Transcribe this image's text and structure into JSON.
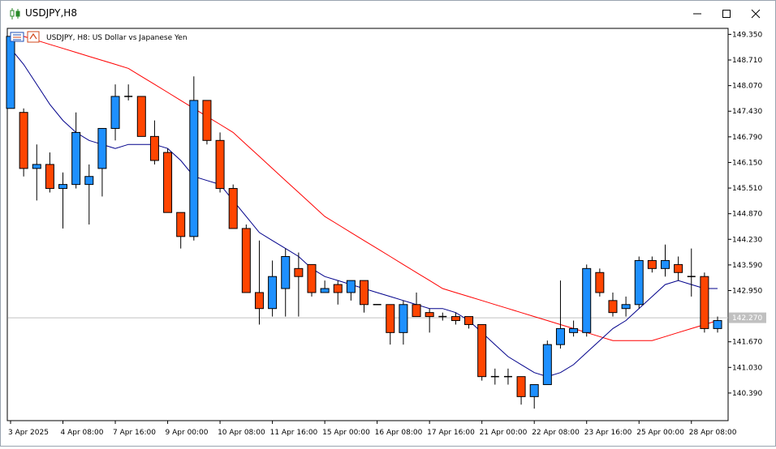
{
  "window": {
    "title": "USDJPY,H8"
  },
  "chart": {
    "symbol_label": "USDJPY, H8:  US Dollar vs Japanese Yen",
    "current_price": "142.270",
    "y_ticks": [
      "149.350",
      "148.710",
      "148.070",
      "147.430",
      "146.790",
      "146.150",
      "145.510",
      "144.870",
      "144.230",
      "143.590",
      "142.950",
      "141.670",
      "141.030",
      "140.390"
    ],
    "x_ticks": [
      "3 Apr 2025",
      "4 Apr 08:00",
      "7 Apr 16:00",
      "9 Apr 00:00",
      "10 Apr 08:00",
      "11 Apr 16:00",
      "15 Apr 00:00",
      "16 Apr 08:00",
      "17 Apr 16:00",
      "21 Apr 00:00",
      "22 Apr 08:00",
      "23 Apr 16:00",
      "25 Apr 00:00",
      "28 Apr 08:00"
    ],
    "colors": {
      "bull": "#1e90ff",
      "bear": "#ff4500",
      "fast_ma": "#00008b",
      "slow_ma": "#ff0000",
      "grid": "#c0c0c0"
    }
  },
  "chart_data": {
    "type": "candlestick",
    "ylim": [
      139.7,
      149.5
    ],
    "candles": [
      {
        "o": 147.5,
        "h": 149.4,
        "l": 147.5,
        "c": 149.3
      },
      {
        "o": 147.4,
        "h": 147.5,
        "l": 145.8,
        "c": 146.0
      },
      {
        "o": 146.0,
        "h": 146.6,
        "l": 145.2,
        "c": 146.1
      },
      {
        "o": 146.1,
        "h": 146.4,
        "l": 145.4,
        "c": 145.5
      },
      {
        "o": 145.5,
        "h": 145.9,
        "l": 144.5,
        "c": 145.6
      },
      {
        "o": 145.6,
        "h": 147.4,
        "l": 145.5,
        "c": 146.9
      },
      {
        "o": 145.6,
        "h": 146.1,
        "l": 144.6,
        "c": 145.8
      },
      {
        "o": 146.0,
        "h": 147.0,
        "l": 145.3,
        "c": 147.0
      },
      {
        "o": 147.0,
        "h": 148.1,
        "l": 146.7,
        "c": 147.8
      },
      {
        "o": 147.8,
        "h": 148.1,
        "l": 147.7,
        "c": 147.8
      },
      {
        "o": 147.8,
        "h": 147.8,
        "l": 146.8,
        "c": 146.8
      },
      {
        "o": 146.8,
        "h": 147.2,
        "l": 146.1,
        "c": 146.2
      },
      {
        "o": 146.4,
        "h": 146.5,
        "l": 144.9,
        "c": 144.9
      },
      {
        "o": 144.9,
        "h": 144.9,
        "l": 144.0,
        "c": 144.3
      },
      {
        "o": 144.3,
        "h": 148.3,
        "l": 144.2,
        "c": 147.7
      },
      {
        "o": 147.7,
        "h": 147.7,
        "l": 146.6,
        "c": 146.7
      },
      {
        "o": 146.7,
        "h": 146.9,
        "l": 145.4,
        "c": 145.5
      },
      {
        "o": 145.5,
        "h": 145.6,
        "l": 144.5,
        "c": 144.5
      },
      {
        "o": 144.5,
        "h": 144.6,
        "l": 142.9,
        "c": 142.9
      },
      {
        "o": 142.9,
        "h": 144.2,
        "l": 142.1,
        "c": 142.5
      },
      {
        "o": 142.5,
        "h": 143.7,
        "l": 142.3,
        "c": 143.3
      },
      {
        "o": 143.0,
        "h": 144.0,
        "l": 142.3,
        "c": 143.8
      },
      {
        "o": 143.5,
        "h": 143.9,
        "l": 142.3,
        "c": 143.3
      },
      {
        "o": 143.6,
        "h": 143.6,
        "l": 142.8,
        "c": 142.9
      },
      {
        "o": 142.9,
        "h": 143.2,
        "l": 142.9,
        "c": 143.0
      },
      {
        "o": 143.1,
        "h": 143.2,
        "l": 142.6,
        "c": 142.9
      },
      {
        "o": 142.9,
        "h": 143.1,
        "l": 142.7,
        "c": 143.2
      },
      {
        "o": 143.2,
        "h": 143.2,
        "l": 142.4,
        "c": 142.6
      },
      {
        "o": 142.6,
        "h": 142.6,
        "l": 142.6,
        "c": 142.6
      },
      {
        "o": 142.6,
        "h": 142.6,
        "l": 141.6,
        "c": 141.9
      },
      {
        "o": 141.9,
        "h": 142.7,
        "l": 141.6,
        "c": 142.6
      },
      {
        "o": 142.6,
        "h": 142.9,
        "l": 142.3,
        "c": 142.3
      },
      {
        "o": 142.4,
        "h": 142.5,
        "l": 141.9,
        "c": 142.3
      },
      {
        "o": 142.3,
        "h": 142.4,
        "l": 142.2,
        "c": 142.3
      },
      {
        "o": 142.3,
        "h": 142.4,
        "l": 142.1,
        "c": 142.2
      },
      {
        "o": 142.3,
        "h": 142.3,
        "l": 142.0,
        "c": 142.1
      },
      {
        "o": 142.1,
        "h": 142.1,
        "l": 140.7,
        "c": 140.8
      },
      {
        "o": 140.8,
        "h": 141.0,
        "l": 140.6,
        "c": 140.8
      },
      {
        "o": 140.8,
        "h": 141.0,
        "l": 140.6,
        "c": 140.8
      },
      {
        "o": 140.8,
        "h": 140.8,
        "l": 140.1,
        "c": 140.3
      },
      {
        "o": 140.3,
        "h": 140.6,
        "l": 140.0,
        "c": 140.6
      },
      {
        "o": 140.6,
        "h": 141.7,
        "l": 140.6,
        "c": 141.6
      },
      {
        "o": 141.6,
        "h": 143.2,
        "l": 141.5,
        "c": 142.0
      },
      {
        "o": 141.9,
        "h": 142.2,
        "l": 141.8,
        "c": 142.0
      },
      {
        "o": 141.9,
        "h": 143.6,
        "l": 141.8,
        "c": 143.5
      },
      {
        "o": 143.4,
        "h": 143.5,
        "l": 142.8,
        "c": 142.9
      },
      {
        "o": 142.7,
        "h": 142.9,
        "l": 142.3,
        "c": 142.4
      },
      {
        "o": 142.5,
        "h": 142.8,
        "l": 142.3,
        "c": 142.6
      },
      {
        "o": 142.6,
        "h": 143.8,
        "l": 142.5,
        "c": 143.7
      },
      {
        "o": 143.7,
        "h": 143.8,
        "l": 143.4,
        "c": 143.5
      },
      {
        "o": 143.5,
        "h": 144.1,
        "l": 143.3,
        "c": 143.7
      },
      {
        "o": 143.6,
        "h": 143.8,
        "l": 143.2,
        "c": 143.4
      },
      {
        "o": 143.3,
        "h": 144.0,
        "l": 142.8,
        "c": 143.3
      },
      {
        "o": 143.3,
        "h": 143.4,
        "l": 141.9,
        "c": 142.0
      },
      {
        "o": 142.0,
        "h": 142.3,
        "l": 141.9,
        "c": 142.2
      }
    ],
    "fast_ma": [
      149.0,
      148.6,
      148.1,
      147.6,
      147.2,
      146.9,
      146.7,
      146.6,
      146.5,
      146.6,
      146.6,
      146.6,
      146.5,
      146.2,
      145.8,
      145.7,
      145.6,
      145.2,
      144.8,
      144.4,
      144.2,
      144.0,
      143.8,
      143.5,
      143.3,
      143.2,
      143.1,
      143.0,
      142.9,
      142.8,
      142.7,
      142.6,
      142.5,
      142.5,
      142.4,
      142.2,
      141.9,
      141.6,
      141.3,
      141.1,
      140.9,
      140.8,
      140.9,
      141.1,
      141.4,
      141.7,
      142.0,
      142.2,
      142.5,
      142.8,
      143.1,
      143.2,
      143.1,
      143.0,
      143.0
    ],
    "slow_ma": [
      149.4,
      149.3,
      149.2,
      149.1,
      149.0,
      148.9,
      148.8,
      148.7,
      148.6,
      148.5,
      148.3,
      148.1,
      147.9,
      147.7,
      147.5,
      147.3,
      147.1,
      146.9,
      146.6,
      146.3,
      146.0,
      145.7,
      145.4,
      145.1,
      144.8,
      144.6,
      144.4,
      144.2,
      144.0,
      143.8,
      143.6,
      143.4,
      143.2,
      143.0,
      142.9,
      142.8,
      142.7,
      142.6,
      142.5,
      142.4,
      142.3,
      142.2,
      142.1,
      142.0,
      141.9,
      141.8,
      141.7,
      141.7,
      141.7,
      141.7,
      141.8,
      141.9,
      142.0,
      142.1,
      142.2
    ]
  }
}
